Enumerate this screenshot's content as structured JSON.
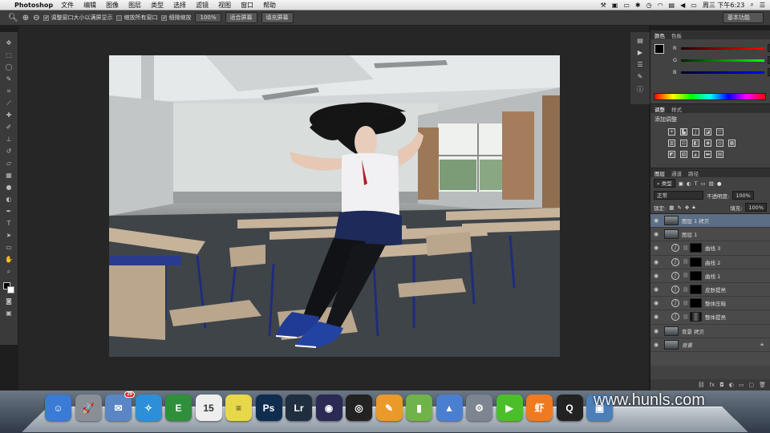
{
  "menubar": {
    "app_name": "Photoshop",
    "menus": [
      "文件",
      "编辑",
      "图像",
      "图层",
      "类型",
      "选择",
      "滤镜",
      "视图",
      "窗口",
      "帮助"
    ],
    "clock": "周三 下午6:23"
  },
  "options": {
    "check1": "调整窗口大小以满屏显示",
    "check2": "缩放所有窗口",
    "check3": "细微缩放",
    "zoom_value": "100%",
    "fit_screen": "适合屏幕",
    "fill_screen": "填充屏幕",
    "workspace": "基本功能"
  },
  "color_panel": {
    "tabs": [
      "颜色",
      "色板"
    ],
    "r_label": "R",
    "g_label": "G",
    "b_label": "B",
    "r_value": "0",
    "g_value": "0",
    "b_value": "0"
  },
  "adjust_panel": {
    "tabs": [
      "调整",
      "样式"
    ],
    "title": "添加调整"
  },
  "layers_panel": {
    "tabs": [
      "图层",
      "通道",
      "路径"
    ],
    "filter_label": "类型",
    "blend_mode": "正常",
    "opacity_label": "不透明度:",
    "opacity_value": "100%",
    "lock_label": "锁定:",
    "fill_label": "填充:",
    "fill_value": "100%",
    "layers": [
      {
        "name": "图层 1 拷贝",
        "kind": "pixel",
        "selected": true
      },
      {
        "name": "图层 1",
        "kind": "pixel",
        "selected": false
      },
      {
        "name": "曲线 3",
        "kind": "adjust",
        "selected": false
      },
      {
        "name": "曲线 2",
        "kind": "adjust",
        "selected": false
      },
      {
        "name": "曲线 1",
        "kind": "adjust",
        "selected": false
      },
      {
        "name": "皮肤提亮",
        "kind": "adjust",
        "selected": false
      },
      {
        "name": "整体压暗",
        "kind": "adjust",
        "selected": false
      },
      {
        "name": "整体提亮",
        "kind": "adjust",
        "selected": false
      },
      {
        "name": "背景 拷贝",
        "kind": "pixel",
        "selected": false
      },
      {
        "name": "背景",
        "kind": "background",
        "selected": false
      }
    ]
  },
  "dock": {
    "icons": [
      {
        "name": "finder-icon",
        "label": "☺",
        "color": "#3a7bd5"
      },
      {
        "name": "launchpad-icon",
        "label": "🚀",
        "color": "#8a8f96"
      },
      {
        "name": "mail-icon",
        "label": "✉",
        "color": "#5b86c5",
        "badge": "29"
      },
      {
        "name": "safari-icon",
        "label": "✧",
        "color": "#2d8fd8"
      },
      {
        "name": "evernote-icon",
        "label": "E",
        "color": "#2f8f3a"
      },
      {
        "name": "calendar-icon",
        "label": "15",
        "color": "#eeeeee"
      },
      {
        "name": "stickies-icon",
        "label": "≡",
        "color": "#e7d84a"
      },
      {
        "name": "photoshop-icon",
        "label": "Ps",
        "color": "#0f2d4f"
      },
      {
        "name": "lightroom-icon",
        "label": "Lr",
        "color": "#1f2f3f"
      },
      {
        "name": "camera-lens-icon",
        "label": "◉",
        "color": "#2a2a55"
      },
      {
        "name": "aperture-icon",
        "label": "◎",
        "color": "#222222"
      },
      {
        "name": "pages-icon",
        "label": "✎",
        "color": "#e99a2a"
      },
      {
        "name": "numbers-icon",
        "label": "▮",
        "color": "#6fb34a"
      },
      {
        "name": "keynote-icon",
        "label": "▲",
        "color": "#4a7fd0"
      },
      {
        "name": "system-preferences-icon",
        "label": "⚙",
        "color": "#7d8590"
      },
      {
        "name": "iqiyi-icon",
        "label": "▶",
        "color": "#4bbf2a"
      },
      {
        "name": "xiami-icon",
        "label": "虾",
        "color": "#f07a1f"
      },
      {
        "name": "qq-icon",
        "label": "Q",
        "color": "#222222"
      },
      {
        "name": "preview-icon",
        "label": "▣",
        "color": "#4b7fb8"
      }
    ],
    "watermark": "www.hunls.com"
  }
}
